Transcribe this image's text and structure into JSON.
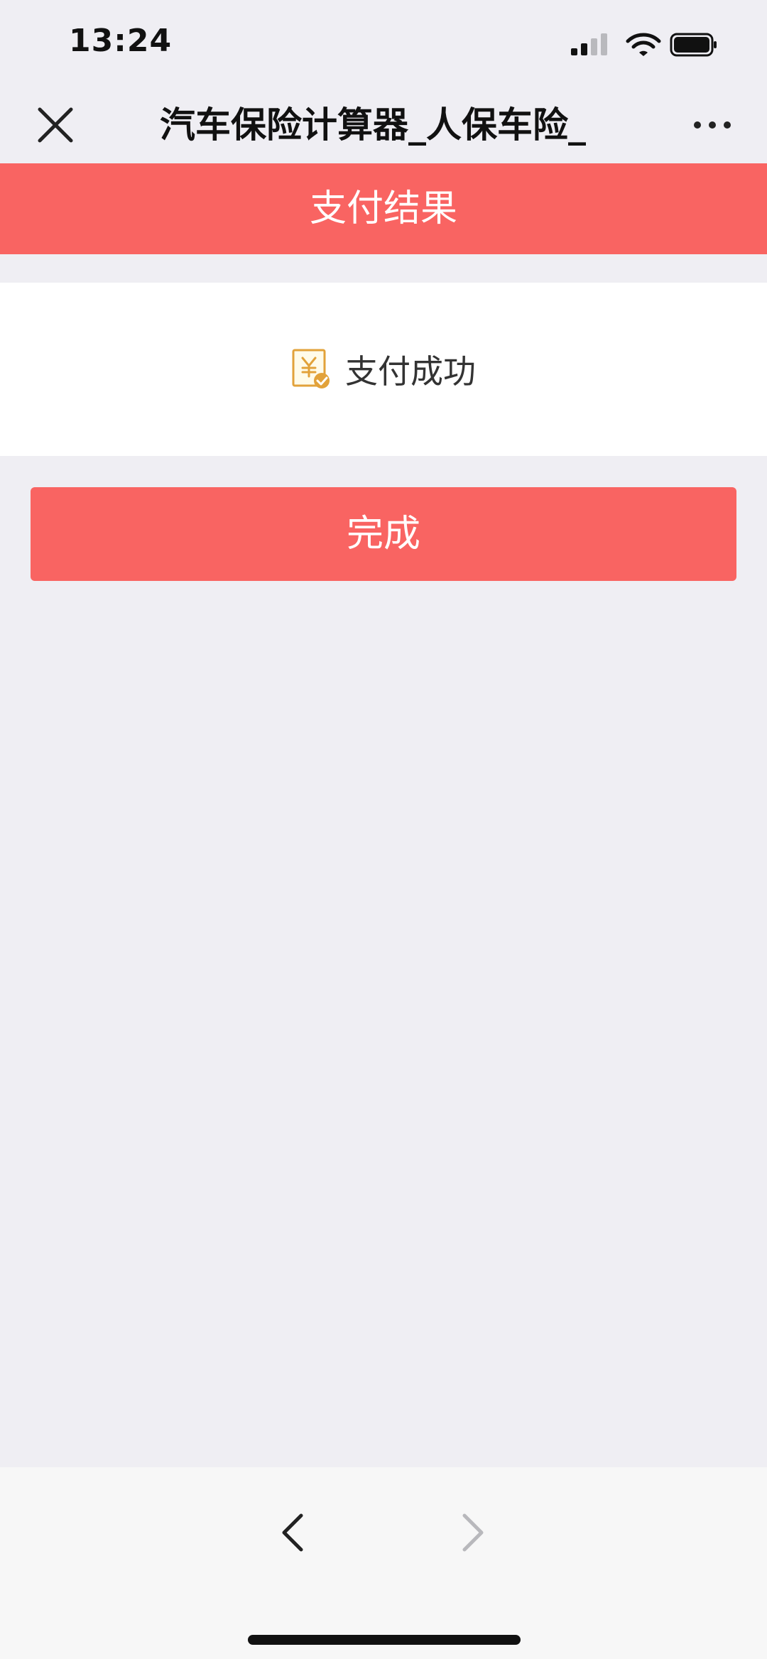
{
  "status_bar": {
    "time": "13:24",
    "icons": [
      "signal-icon",
      "wifi-icon",
      "battery-icon"
    ]
  },
  "nav": {
    "title": "汽车保险计算器_人保车险_",
    "close_icon": "close-icon",
    "more_icon": "more-icon"
  },
  "header": {
    "title": "支付结果"
  },
  "result": {
    "icon": "payment-success-icon",
    "text": "支付成功"
  },
  "actions": {
    "done_label": "完成"
  },
  "bottom_nav": {
    "back_icon": "back-arrow-icon",
    "forward_icon": "forward-arrow-icon"
  },
  "colors": {
    "accent": "#f96462",
    "background": "#efeef3",
    "icon_gold": "#e2a23a"
  }
}
